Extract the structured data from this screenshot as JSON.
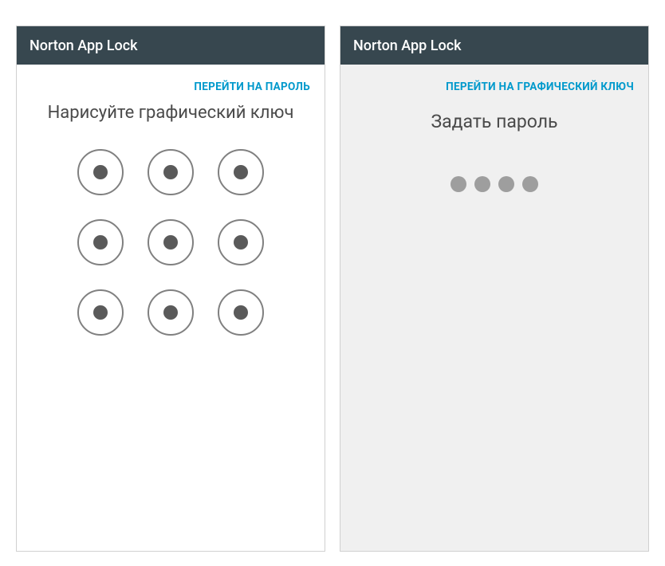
{
  "screens": {
    "left": {
      "app_title": "Norton App Lock",
      "switch_link": "ПЕРЕЙТИ НА ПАРОЛЬ",
      "instruction": "Нарисуйте графический ключ",
      "pattern_size": 9
    },
    "right": {
      "app_title": "Norton App Lock",
      "switch_link": "ПЕРЕЙТИ НА ГРАФИЧЕСКИЙ КЛЮЧ",
      "instruction": "Задать пароль",
      "pin_length": 4
    }
  }
}
